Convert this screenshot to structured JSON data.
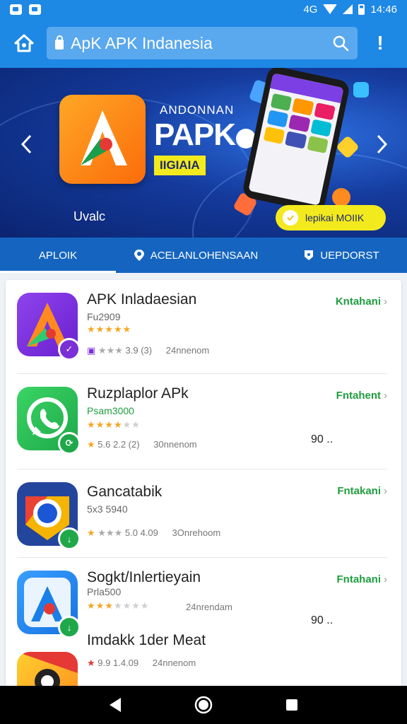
{
  "status": {
    "time": "14:46",
    "left": "4G"
  },
  "header": {
    "home_icon": "home-icon",
    "search_text": "ApK APK Indanesia",
    "search_icon": "search-icon",
    "alert_icon": "alert-icon",
    "colors": {
      "bar": "#1e88e5",
      "search": "#5aa8ee"
    }
  },
  "banner": {
    "subtitle": "ANDONNAN",
    "title": "PAPK",
    "tag": "IIGIAIA",
    "footer": "Uvalc",
    "cta": "lepikai MOIIK"
  },
  "tabs": [
    {
      "label": "APLOIK",
      "active": true
    },
    {
      "label": "ACELANLOHENSAAN",
      "active": false
    },
    {
      "label": "UEPDORST",
      "active": false
    }
  ],
  "apps": [
    {
      "name": "APK Inladaesian",
      "price": "Fu2909",
      "stars": 5,
      "rating": "3.9",
      "meta_extra": "(3)",
      "downloads": "24nnenom",
      "action": "Kntahani",
      "count": ""
    },
    {
      "name": "Ruzplaplor APk",
      "price": "Psam3000",
      "stars": 4,
      "rating": "5.6",
      "meta_extra": "2.2 (2)",
      "downloads": "30nnenom",
      "action": "Fntahent",
      "count": "90 .."
    },
    {
      "name": "Gancatabik",
      "price": "5x3 5940",
      "stars": 0,
      "rating": "5.0",
      "meta_extra": "4.09",
      "downloads": "3Onrehoom",
      "action": "Fntakani",
      "count": ""
    },
    {
      "name": "Sogkt/Inlertieyain",
      "price": "Prla500",
      "stars": 3,
      "rating": "",
      "meta_extra": "",
      "downloads": "24nrendam",
      "action": "Fntahani",
      "count": "90 .."
    },
    {
      "name": "Imdakk 1der Meat",
      "price": "",
      "stars": 0,
      "rating": "9.9",
      "meta_extra": "1.4.09",
      "downloads": "24nnenom",
      "action": "",
      "count": ""
    }
  ],
  "nav": {
    "back_icon": "back-icon",
    "home_icon": "home-circle-icon",
    "recents_icon": "recents-icon"
  }
}
